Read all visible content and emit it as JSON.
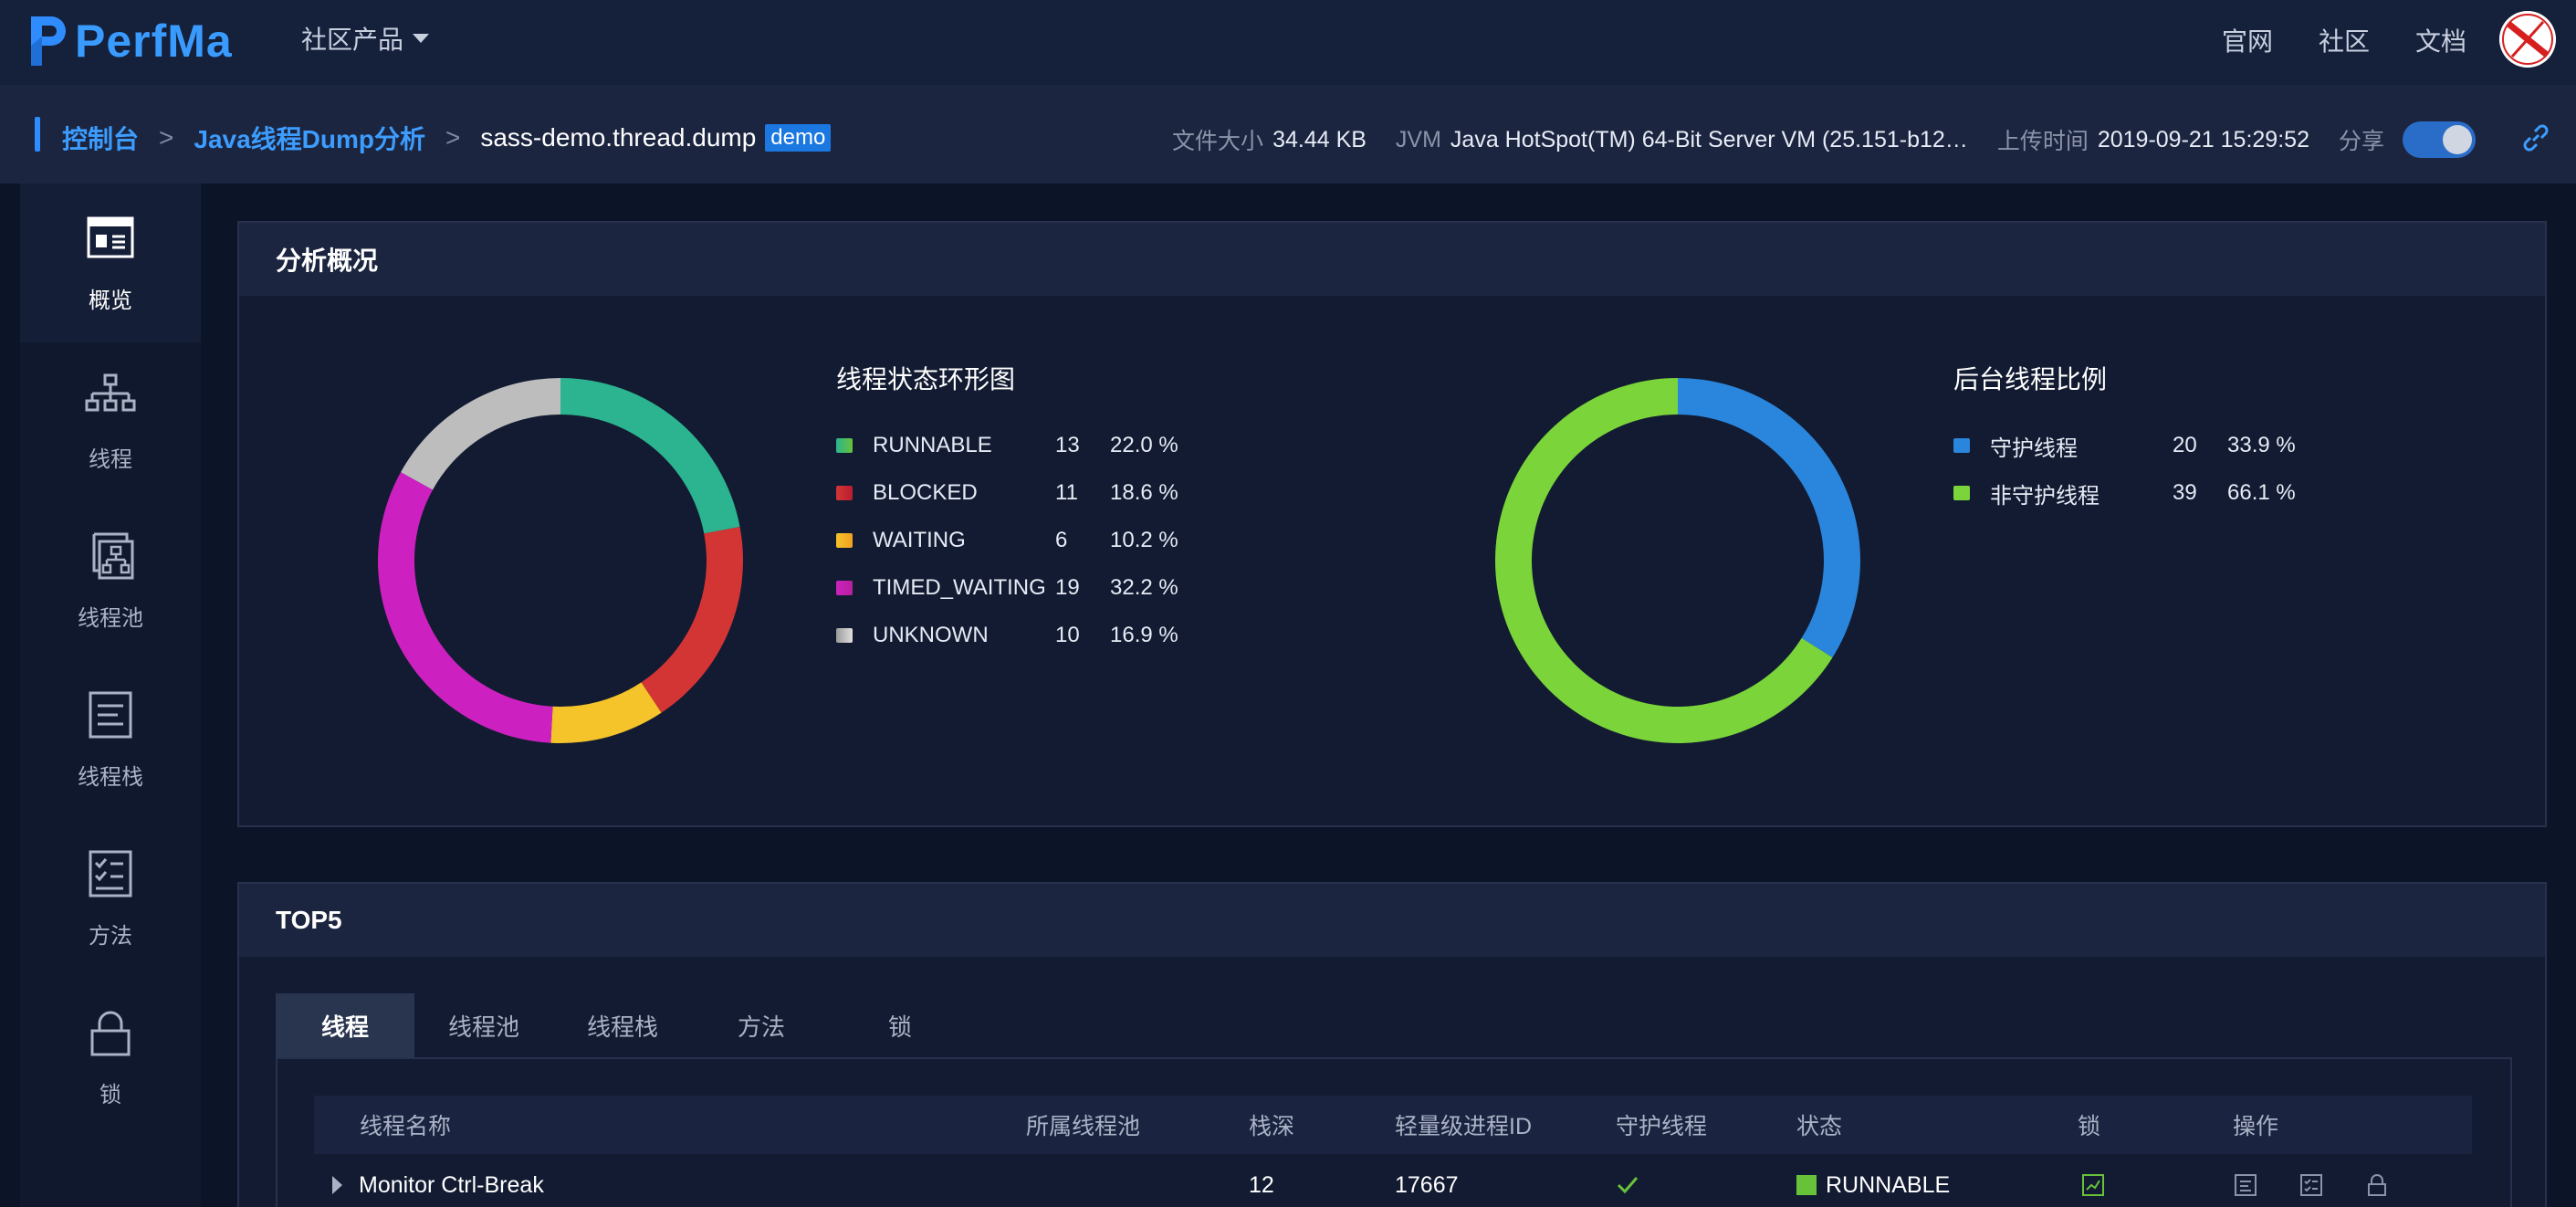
{
  "brand": {
    "name": "PerfMa",
    "color": "#3a9bff"
  },
  "topnav": {
    "products_label": "社区产品",
    "links": [
      "官网",
      "社区",
      "文档"
    ]
  },
  "breadcrumb": {
    "items": [
      "控制台",
      "Java线程Dump分析",
      "sass-demo.thread.dump"
    ],
    "separator": ">",
    "badge": "demo"
  },
  "meta": {
    "file_size_label": "文件大小",
    "file_size": "34.44 KB",
    "jvm_label": "JVM",
    "jvm": "Java HotSpot(TM) 64-Bit Server VM (25.151-b12…",
    "upload_label": "上传时间",
    "upload_time": "2019-09-21 15:29:52",
    "share_label": "分享",
    "share_enabled": true
  },
  "sidebar": {
    "items": [
      {
        "label": "概览",
        "icon": "overview-icon",
        "active": true
      },
      {
        "label": "线程",
        "icon": "thread-tree-icon",
        "active": false
      },
      {
        "label": "线程池",
        "icon": "thread-pool-icon",
        "active": false
      },
      {
        "label": "线程栈",
        "icon": "thread-stack-icon",
        "active": false
      },
      {
        "label": "方法",
        "icon": "method-checklist-icon",
        "active": false
      },
      {
        "label": "锁",
        "icon": "lock-icon",
        "active": false
      }
    ]
  },
  "overview": {
    "title": "分析概况",
    "state_chart_title": "线程状态环形图",
    "daemon_chart_title": "后台线程比例"
  },
  "chart_data": [
    {
      "type": "pie",
      "title": "线程状态环形图",
      "categories": [
        "RUNNABLE",
        "BLOCKED",
        "WAITING",
        "TIMED_WAITING",
        "UNKNOWN"
      ],
      "values": [
        13,
        11,
        6,
        19,
        10
      ],
      "percent_labels": [
        "22.0 %",
        "18.6 %",
        "10.2 %",
        "32.2 %",
        "16.9 %"
      ],
      "colors": [
        "#2bb48f",
        "#d33535",
        "#f5c32a",
        "#cc21c0",
        "#bdbdbd"
      ]
    },
    {
      "type": "pie",
      "title": "后台线程比例",
      "categories": [
        "守护线程",
        "非守护线程"
      ],
      "values": [
        20,
        39
      ],
      "percent_labels": [
        "33.9 %",
        "66.1 %"
      ],
      "colors": [
        "#2a86dc",
        "#7ad43a"
      ]
    }
  ],
  "top5": {
    "title": "TOP5",
    "tabs": [
      "线程",
      "线程池",
      "线程栈",
      "方法",
      "锁"
    ],
    "active_tab": 0,
    "columns": [
      "线程名称",
      "所属线程池",
      "栈深",
      "轻量级进程ID",
      "守护线程",
      "状态",
      "锁",
      "操作"
    ],
    "rows": [
      {
        "name": "Monitor Ctrl-Break",
        "pool": "",
        "depth": "12",
        "lwp_id": "17667",
        "daemon": true,
        "state": "RUNNABLE",
        "state_color": "#67c23a"
      }
    ]
  }
}
